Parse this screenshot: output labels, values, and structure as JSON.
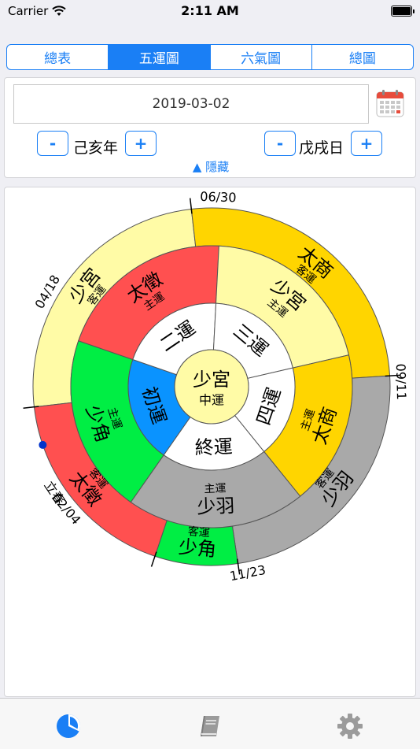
{
  "status_bar": {
    "carrier": "Carrier",
    "time": "2:11 AM"
  },
  "segments": [
    {
      "label": "總表",
      "active": false
    },
    {
      "label": "五運圖",
      "active": true
    },
    {
      "label": "六氣圖",
      "active": false
    },
    {
      "label": "總圖",
      "active": false
    }
  ],
  "controls": {
    "date": "2019-03-02",
    "minus": "-",
    "plus": "+",
    "year": "己亥年",
    "day": "戊戌日",
    "toggle": "▲ 隱藏"
  },
  "wheel": {
    "center": {
      "title": "少宮",
      "subtitle": "中運"
    },
    "inner_ring": [
      {
        "label": "初運",
        "color": "#0a93ff"
      },
      {
        "label": "二運",
        "color": "#ffffff"
      },
      {
        "label": "三運",
        "color": "#ffffff"
      },
      {
        "label": "四運",
        "color": "#ffffff"
      },
      {
        "label": "終運",
        "color": "#ffffff"
      }
    ],
    "host_ring": [
      {
        "name": "少角",
        "sub": "主運",
        "color": "#00ee44"
      },
      {
        "name": "太徵",
        "sub": "主運",
        "color": "#ff5050"
      },
      {
        "name": "少宮",
        "sub": "主運",
        "color": "#fffba6"
      },
      {
        "name": "太商",
        "sub": "主運",
        "color": "#ffd500"
      },
      {
        "name": "少羽",
        "sub": "主運",
        "color": "#a9a9a9"
      }
    ],
    "guest_ring": [
      {
        "name": "少宮",
        "sub": "客運",
        "color": "#fffba6"
      },
      {
        "name": "太商",
        "sub": "客運",
        "color": "#ffd500"
      },
      {
        "name": "少羽",
        "sub": "客運",
        "color": "#a9a9a9"
      },
      {
        "name": "少角",
        "sub": "客運",
        "color": "#00ee44"
      },
      {
        "name": "太徵",
        "sub": "客運",
        "color": "#ff5050"
      }
    ],
    "boundaries": [
      "04/18",
      "06/30",
      "09/11",
      "11/23",
      "02/04"
    ],
    "solar_term": "立春",
    "current_marker_color": "#0033cc"
  },
  "tabs": [
    {
      "icon": "pie-chart-icon",
      "active": true
    },
    {
      "icon": "book-icon",
      "active": false
    },
    {
      "icon": "gear-icon",
      "active": false
    }
  ]
}
